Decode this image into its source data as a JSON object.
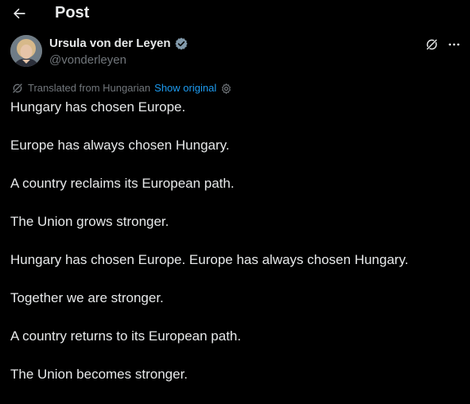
{
  "header": {
    "title": "Post",
    "back_icon": "arrow-left-icon"
  },
  "author": {
    "name": "Ursula von der Leyen",
    "handle": "@vonderleyen",
    "verified_color": "#829aab"
  },
  "actions": {
    "grok_icon": "grok-icon",
    "more_icon": "more-horizontal-icon"
  },
  "translation": {
    "label": "Translated from Hungarian",
    "link": "Show original",
    "link_color": "#1d9bf0"
  },
  "post": {
    "lines": [
      "Hungary has chosen Europe.",
      "Europe has always chosen Hungary.",
      "A country reclaims its European path.",
      "The Union grows stronger.",
      "Hungary has chosen Europe. Europe has always chosen Hungary.",
      "Together we are stronger.",
      "A country returns to its European path.",
      "The Union becomes stronger."
    ]
  },
  "theme": {
    "background": "#000000",
    "text": "#e7e9ea",
    "muted": "#71767b"
  }
}
